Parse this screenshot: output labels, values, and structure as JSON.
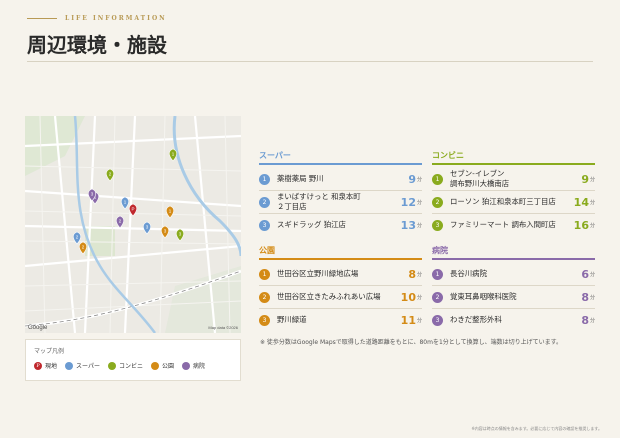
{
  "header": {
    "eyebrow": "LIFE INFORMATION",
    "title": "周辺環境・施設"
  },
  "map": {
    "logo": "Google",
    "credit": "Map data ©2026"
  },
  "legend": {
    "title": "マップ凡例",
    "items": [
      {
        "label": "現地",
        "color": "#c0282d",
        "mark": "P"
      },
      {
        "label": "スーパー",
        "color": "#6b9bd2",
        "mark": ""
      },
      {
        "label": "コンビニ",
        "color": "#8aab1e",
        "mark": ""
      },
      {
        "label": "公園",
        "color": "#d48b16",
        "mark": ""
      },
      {
        "label": "病院",
        "color": "#8a6aa9",
        "mark": ""
      }
    ]
  },
  "sections": {
    "supermarket": {
      "title": "スーパー",
      "color": "#6b9bd2",
      "items": [
        {
          "num": "1",
          "name": "薬樹薬局 野川",
          "dist": "9",
          "unit": "分"
        },
        {
          "num": "2",
          "name": "まいばすけっと 和泉本町\n２丁目店",
          "dist": "12",
          "unit": "分"
        },
        {
          "num": "3",
          "name": "スギドラッグ 狛江店",
          "dist": "13",
          "unit": "分"
        }
      ]
    },
    "convenience": {
      "title": "コンビニ",
      "color": "#8aab1e",
      "items": [
        {
          "num": "1",
          "name": "セブン-イレブン\n調布野川大橋南店",
          "dist": "9",
          "unit": "分"
        },
        {
          "num": "2",
          "name": "ローソン 狛江和泉本町三丁目店",
          "dist": "14",
          "unit": "分"
        },
        {
          "num": "3",
          "name": "ファミリーマート 調布入間町店",
          "dist": "16",
          "unit": "分"
        }
      ]
    },
    "park": {
      "title": "公園",
      "color": "#d48b16",
      "items": [
        {
          "num": "1",
          "name": "世田谷区立野川緑地広場",
          "dist": "8",
          "unit": "分"
        },
        {
          "num": "2",
          "name": "世田谷区立きたみふれあい広場",
          "dist": "10",
          "unit": "分"
        },
        {
          "num": "3",
          "name": "野川緑道",
          "dist": "11",
          "unit": "分"
        }
      ]
    },
    "hospital": {
      "title": "病院",
      "color": "#8a6aa9",
      "items": [
        {
          "num": "1",
          "name": "長谷川病院",
          "dist": "6",
          "unit": "分"
        },
        {
          "num": "2",
          "name": "覚東耳鼻咽喉科医院",
          "dist": "8",
          "unit": "分"
        },
        {
          "num": "3",
          "name": "わきだ整形外科",
          "dist": "8",
          "unit": "分"
        }
      ]
    }
  },
  "note": "※ 徒歩分数はGoogle Mapsで取得した道路距離をもとに、80mを1分として換算し、端数は切り上げています。",
  "footer": "※内容は時点の情報を含みます。必要に応じて内容の確認を推奨します。"
}
